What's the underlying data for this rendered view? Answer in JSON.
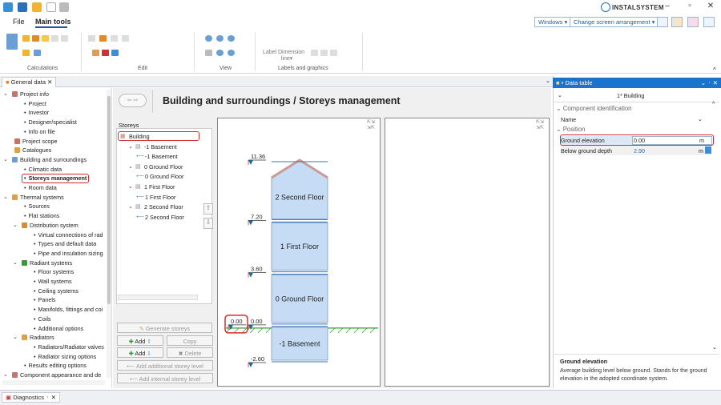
{
  "ribbon": {
    "file_tab": "File",
    "main_tab": "Main tools",
    "groups": [
      "Calculations",
      "Edit",
      "View",
      "Labels and graphics"
    ],
    "label_btn": "Label",
    "dimension_btn": "Dimension",
    "line_btn": "line"
  },
  "topbar": {
    "windows_select": "Windows",
    "arrangement_select": "Change screen arrangement",
    "brand": "INSTALSYSTEM"
  },
  "tabs": {
    "general_data": "General data",
    "diagnostics": "Diagnostics"
  },
  "tree": [
    {
      "label": "Project info",
      "level": 0,
      "arrow": "v"
    },
    {
      "label": "Project",
      "level": 2,
      "bullet": true
    },
    {
      "label": "Investor",
      "level": 2,
      "bullet": true
    },
    {
      "label": "Designer/specialist",
      "level": 2,
      "bullet": true
    },
    {
      "label": "Info on file",
      "level": 2,
      "bullet": true
    },
    {
      "label": "Project scope",
      "level": 1
    },
    {
      "label": "Catalogues",
      "level": 1
    },
    {
      "label": "Building and surroundings",
      "level": 0,
      "arrow": "v"
    },
    {
      "label": "Climatic data",
      "level": 2,
      "bullet": true
    },
    {
      "label": "Storeys management",
      "level": 2,
      "bullet": true,
      "selected": true
    },
    {
      "label": "Room data",
      "level": 2,
      "bullet": true
    },
    {
      "label": "Thermal systems",
      "level": 0,
      "arrow": "v"
    },
    {
      "label": "Sources",
      "level": 2,
      "bullet": true
    },
    {
      "label": "Flat stations",
      "level": 2,
      "bullet": true
    },
    {
      "label": "Distribution system",
      "level": 1,
      "arrow": "v"
    },
    {
      "label": "Virtual connections of rad",
      "level": 3,
      "bullet": true
    },
    {
      "label": "Types and default data",
      "level": 3,
      "bullet": true
    },
    {
      "label": "Pipe and insulation sizing",
      "level": 3,
      "bullet": true
    },
    {
      "label": "Radiant systems",
      "level": 1,
      "arrow": "v"
    },
    {
      "label": "Floor systems",
      "level": 3,
      "bullet": true
    },
    {
      "label": "Wall systems",
      "level": 3,
      "bullet": true
    },
    {
      "label": "Ceiling systems",
      "level": 3,
      "bullet": true
    },
    {
      "label": "Panels",
      "level": 3,
      "bullet": true
    },
    {
      "label": "Manifolds, fittings and coi",
      "level": 3,
      "bullet": true
    },
    {
      "label": "Coils",
      "level": 3,
      "bullet": true
    },
    {
      "label": "Additional options",
      "level": 3,
      "bullet": true
    },
    {
      "label": "Radiators",
      "level": 1,
      "arrow": "v"
    },
    {
      "label": "Radiators/Radiator valves",
      "level": 3,
      "bullet": true
    },
    {
      "label": "Radiator sizing options",
      "level": 3,
      "bullet": true
    },
    {
      "label": "Results editing options",
      "level": 2,
      "bullet": true
    },
    {
      "label": "Component appearance and de",
      "level": 0,
      "arrow": "v"
    }
  ],
  "main": {
    "title": "Building and surroundings / Storeys management",
    "storeys_label": "Storeys",
    "storeys": [
      {
        "label": "Building",
        "indent": 0,
        "selected": true
      },
      {
        "label": "-1 Basement",
        "indent": 1,
        "arrow": "v"
      },
      {
        "label": "-1 Basement",
        "indent": 2,
        "level": true
      },
      {
        "label": "0 Ground Floor",
        "indent": 1,
        "arrow": "v"
      },
      {
        "label": "0 Ground Floor",
        "indent": 2,
        "level": true
      },
      {
        "label": "1 First Floor",
        "indent": 1,
        "arrow": "v"
      },
      {
        "label": "1 First Floor",
        "indent": 2,
        "level": true
      },
      {
        "label": "2 Second Floor",
        "indent": 1,
        "arrow": "v"
      },
      {
        "label": "2 Second Floor",
        "indent": 2,
        "level": true
      }
    ],
    "buttons": {
      "generate": "Generate storeys",
      "add1": "Add",
      "copy": "Copy",
      "add2": "Add",
      "delete": "Delete",
      "add_additional": "Add additional storey level",
      "add_internal": "Add internal storey level"
    }
  },
  "drawing": {
    "floors": [
      {
        "name": "-1 Basement",
        "bottom": -2.6,
        "top": 0.0
      },
      {
        "name": "0 Ground Floor",
        "bottom": 0.0,
        "top": 3.6
      },
      {
        "name": "1 First Floor",
        "bottom": 3.6,
        "top": 7.2
      },
      {
        "name": "2 Second Floor",
        "bottom": 7.2,
        "top": 11.36
      }
    ],
    "level_labels": [
      "11.36",
      "7.20",
      "3.60",
      "0.00",
      "0.00",
      "-2.60"
    ],
    "floor_color": "#c5dcf4",
    "roof_color": "#c89a98"
  },
  "data_table": {
    "title": "Data table",
    "subtitle": "1* Building",
    "section1": "Component identification",
    "name_label": "Name",
    "section2": "Position",
    "ground_elevation_label": "Ground elevation",
    "ground_elevation_value": "0.00",
    "ground_elevation_unit": "m",
    "below_ground_label": "Below ground depth",
    "below_ground_value": "2.90",
    "below_ground_unit": "m",
    "desc_title": "Ground elevation",
    "desc_text": "Average building level below ground. Stands for the ground elevation in the adopted coordinate system."
  }
}
